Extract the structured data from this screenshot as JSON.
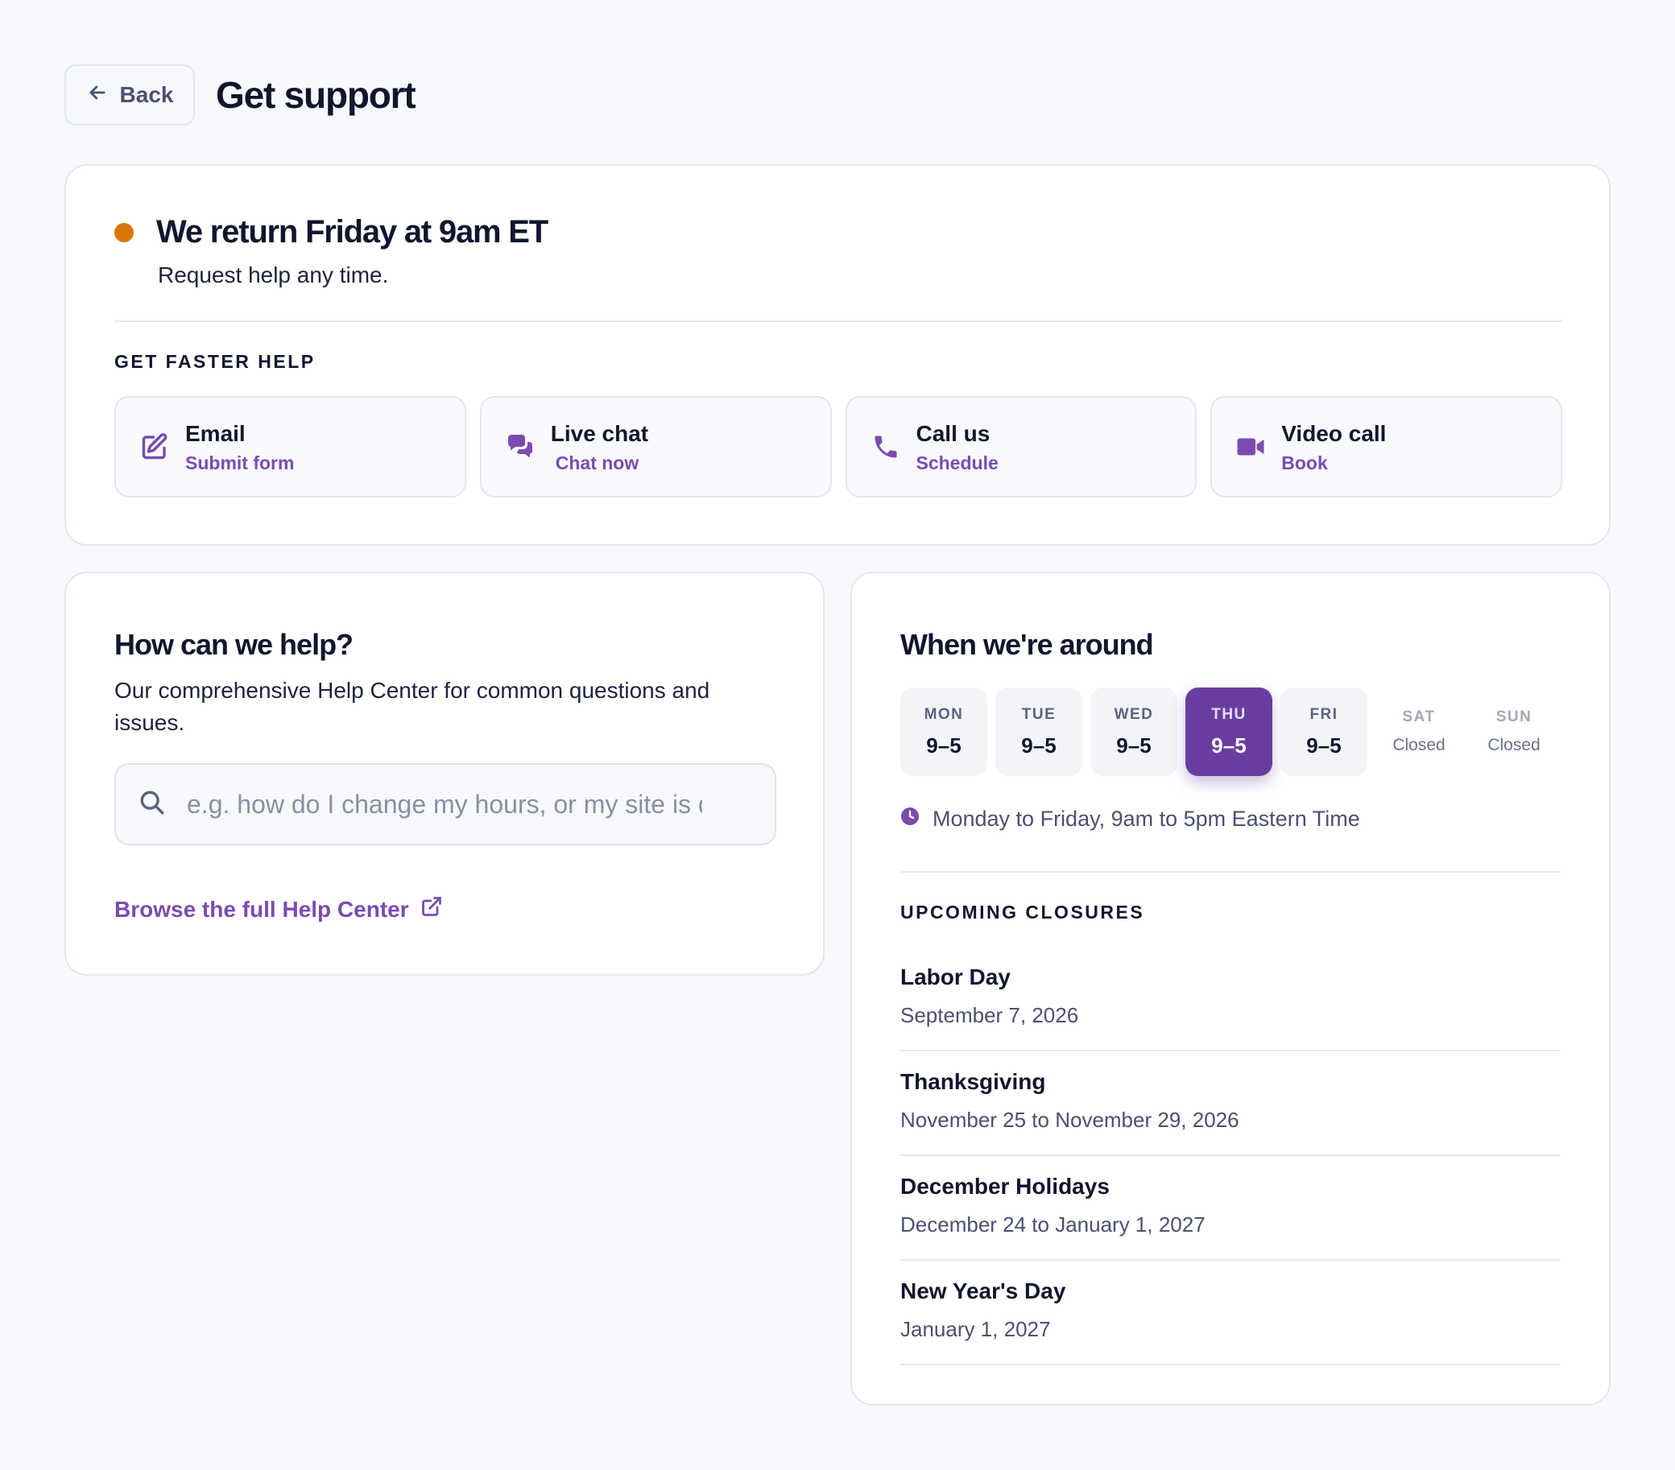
{
  "header": {
    "back_label": "Back",
    "title": "Get support"
  },
  "status": {
    "title": "We return Friday at 9am ET",
    "subtitle": "Request help any time.",
    "dot_color": "#d97706"
  },
  "faster_help": {
    "label": "GET FASTER HELP",
    "options": [
      {
        "icon": "edit-icon",
        "title": "Email",
        "action": "Submit form"
      },
      {
        "icon": "chat-icon",
        "title": "Live chat",
        "action": "Chat now"
      },
      {
        "icon": "phone-icon",
        "title": "Call us",
        "action": "Schedule"
      },
      {
        "icon": "video-icon",
        "title": "Video call",
        "action": "Book"
      }
    ]
  },
  "help": {
    "title": "How can we help?",
    "description": "Our comprehensive Help Center for common questions and issues.",
    "search_placeholder": "e.g. how do I change my hours, or my site is down",
    "browse_label": "Browse the full Help Center"
  },
  "hours": {
    "title": "When we're around",
    "days": [
      {
        "name": "MON",
        "hours": "9–5"
      },
      {
        "name": "TUE",
        "hours": "9–5"
      },
      {
        "name": "WED",
        "hours": "9–5"
      },
      {
        "name": "THU",
        "hours": "9–5",
        "active": true
      },
      {
        "name": "FRI",
        "hours": "9–5"
      },
      {
        "name": "SAT",
        "hours": "Closed"
      },
      {
        "name": "SUN",
        "hours": "Closed"
      }
    ],
    "note": "Monday to Friday, 9am to 5pm Eastern Time"
  },
  "closures": {
    "label": "UPCOMING CLOSURES",
    "items": [
      {
        "name": "Labor Day",
        "date": "September 7, 2026"
      },
      {
        "name": "Thanksgiving",
        "date": "November 25 to November 29, 2026"
      },
      {
        "name": "December Holidays",
        "date": "December 24 to January 1, 2027"
      },
      {
        "name": "New Year's Day",
        "date": "January 1, 2027"
      }
    ]
  },
  "colors": {
    "accent": "#7b4bb0",
    "accent_dark": "#6a3ea1",
    "status": "#d97706"
  }
}
